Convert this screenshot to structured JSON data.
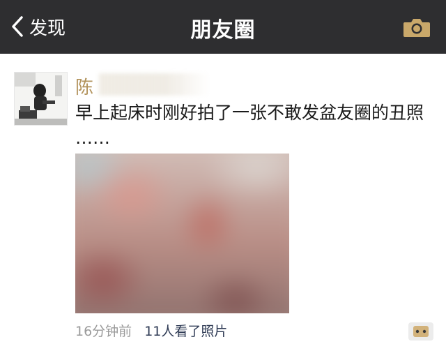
{
  "navbar": {
    "back_label": "发现",
    "title": "朋友圈",
    "back_icon": "chevron-left-icon",
    "camera_icon": "camera-icon",
    "camera_color": "#c9a86a",
    "background": "#2e2e30"
  },
  "post": {
    "username": "陈",
    "text_line1": "早上起床时刚好拍了一张不敢发盆友圈的丑照",
    "text_line2": "……",
    "time": "16分钟前",
    "views": "11人看了照片",
    "comment_icon": "comment-dots-icon",
    "username_color": "#b2935c"
  }
}
